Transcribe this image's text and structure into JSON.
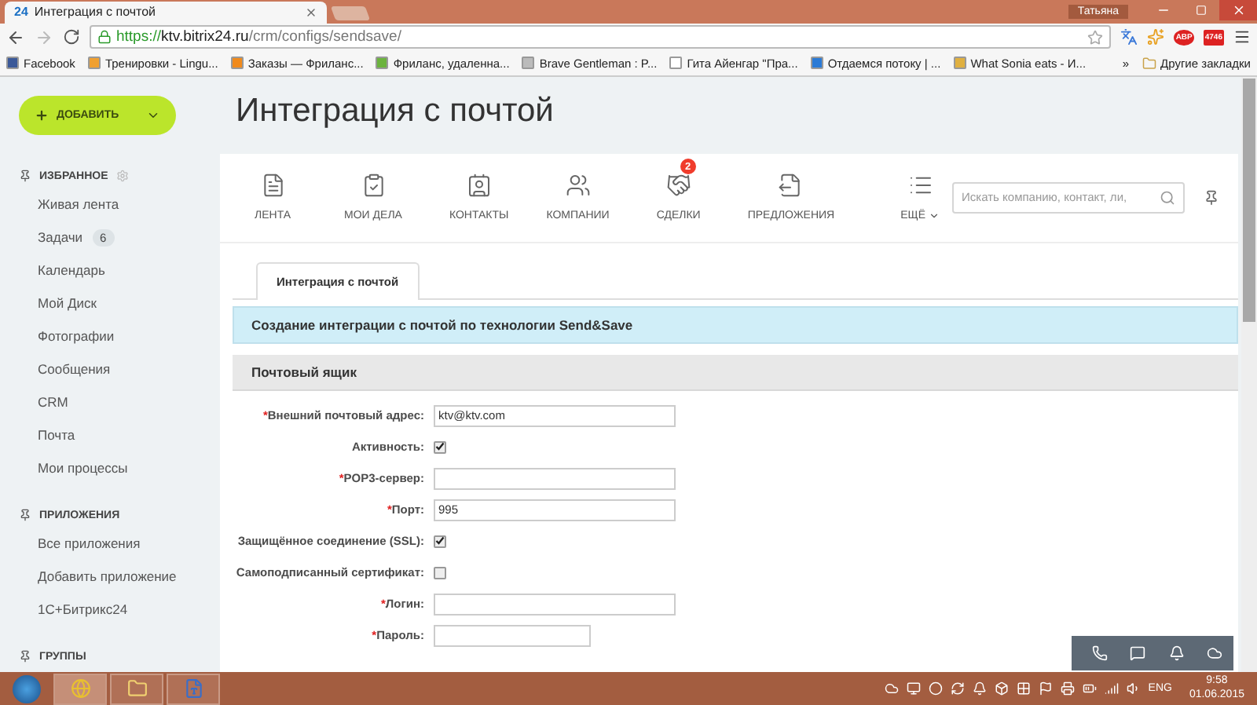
{
  "browser": {
    "tab": {
      "favicon": "24",
      "title": "Интеграция с почтой",
      "selected": true
    },
    "user": "Татьяна",
    "url": {
      "scheme": "https://",
      "host": "ktv.bitrix24.ru",
      "path": "/crm/configs/sendsave/"
    },
    "extension_badges": [
      "ABP",
      "4746"
    ],
    "bookmarks": [
      {
        "label": "Facebook",
        "color": "#3b5998"
      },
      {
        "label": "Тренировки - Lingu...",
        "color": "#f0a030"
      },
      {
        "label": "Заказы — Фриланс...",
        "color": "#f08a1c"
      },
      {
        "label": "Фриланс, удаленна...",
        "color": "#6cb33e"
      },
      {
        "label": "Brave Gentleman : P...",
        "color": "#bbbbbb"
      },
      {
        "label": "Гита Айенгар \"Пра...",
        "color": "#ffffff"
      },
      {
        "label": "Отдаемся потоку | ...",
        "color": "#2a7ad6"
      },
      {
        "label": "What Sonia eats - И...",
        "color": "#e0b040"
      }
    ],
    "more_bookmarks": "»",
    "other_bookmarks": "Другие закладки"
  },
  "add_button": {
    "label": "ДОБАВИТЬ"
  },
  "page_title": "Интеграция с почтой",
  "sidebar": [
    {
      "kind": "section",
      "label": "ИЗБРАННОЕ"
    },
    {
      "kind": "item",
      "label": "Живая лента"
    },
    {
      "kind": "item",
      "label": "Задачи",
      "badge": "6"
    },
    {
      "kind": "item",
      "label": "Календарь"
    },
    {
      "kind": "item",
      "label": "Мой Диск"
    },
    {
      "kind": "item",
      "label": "Фотографии"
    },
    {
      "kind": "item",
      "label": "Сообщения"
    },
    {
      "kind": "item",
      "label": "CRM"
    },
    {
      "kind": "item",
      "label": "Почта"
    },
    {
      "kind": "item",
      "label": "Мои процессы"
    },
    {
      "kind": "section",
      "label": "ПРИЛОЖЕНИЯ"
    },
    {
      "kind": "item",
      "label": "Все приложения"
    },
    {
      "kind": "item",
      "label": "Добавить приложение"
    },
    {
      "kind": "item",
      "label": "1С+Битрикс24"
    },
    {
      "kind": "section",
      "label": "ГРУППЫ"
    }
  ],
  "crm_nav": [
    {
      "kind": "feed",
      "label": "ЛЕНТА"
    },
    {
      "kind": "tasks",
      "label": "МОИ ДЕЛА"
    },
    {
      "kind": "contacts",
      "label": "КОНТАКТЫ"
    },
    {
      "kind": "companies",
      "label": "КОМПАНИИ"
    },
    {
      "kind": "deals",
      "label": "СДЕЛКИ",
      "badge": "2"
    },
    {
      "kind": "quotes",
      "label": "ПРЕДЛОЖЕНИЯ"
    },
    {
      "kind": "more",
      "label": "ЕЩЁ"
    }
  ],
  "search": {
    "placeholder": "Искать компанию, контакт, ли,"
  },
  "tabs": [
    {
      "label": "Интеграция с почтой",
      "selected": true
    }
  ],
  "banner": "Создание интеграции с почтой по технологии Send&Save",
  "section_title": "Почтовый ящик",
  "required_mark": "*",
  "fields": [
    {
      "kind": "text",
      "label": "Внешний почтовый адрес:",
      "required": true,
      "value": "ktv@ktv.com"
    },
    {
      "kind": "checkbox",
      "label": "Активность:",
      "required": false,
      "checked": true
    },
    {
      "kind": "text",
      "label": "POP3-сервер:",
      "required": true
    },
    {
      "kind": "text",
      "label": "Порт:",
      "required": true,
      "value": "995"
    },
    {
      "kind": "checkbox",
      "label": "Защищённое соединение (SSL):",
      "required": false,
      "checked": true
    },
    {
      "kind": "checkbox",
      "label": "Самоподписанный сертификат:",
      "required": false,
      "checked": false
    },
    {
      "kind": "text",
      "label": "Логин:",
      "required": true
    },
    {
      "kind": "password",
      "label": "Пароль:",
      "required": true
    }
  ],
  "taskbar": {
    "language": "ENG",
    "time": "9:58",
    "date": "01.06.2015"
  }
}
